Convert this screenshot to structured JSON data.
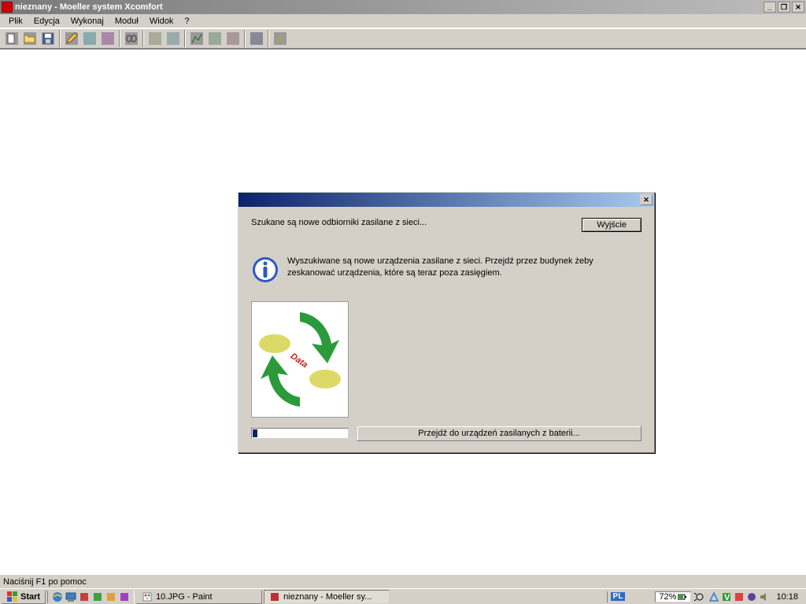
{
  "titlebar": {
    "text": "nieznany - Moeller system Xcomfort"
  },
  "menu": {
    "items": [
      "Plik",
      "Edycja",
      "Wykonaj",
      "Moduł",
      "Widok",
      "?"
    ]
  },
  "statusbar": {
    "text": "Naciśnij F1 po pomoc"
  },
  "dialog": {
    "heading": "Szukane są nowe odbiorniki zasilane z sieci...",
    "exit_button": "Wyjście",
    "info_text": "Wyszukiwane są nowe urządzenia zasilane z sieci. Przejdź przez budynek żeby zeskanować urządzenia, które są teraz poza zasięgiem.",
    "data_label": "Data",
    "battery_button": "Przejdź do urządzeń zasilanych z baterii...",
    "progress_percent": 5
  },
  "taskbar": {
    "start": "Start",
    "tasks": [
      {
        "label": "10.JPG - Paint",
        "active": false
      },
      {
        "label": "nieznany - Moeller sy...",
        "active": true
      }
    ],
    "lang": "PL",
    "battery": "72%",
    "clock": "10:18"
  }
}
